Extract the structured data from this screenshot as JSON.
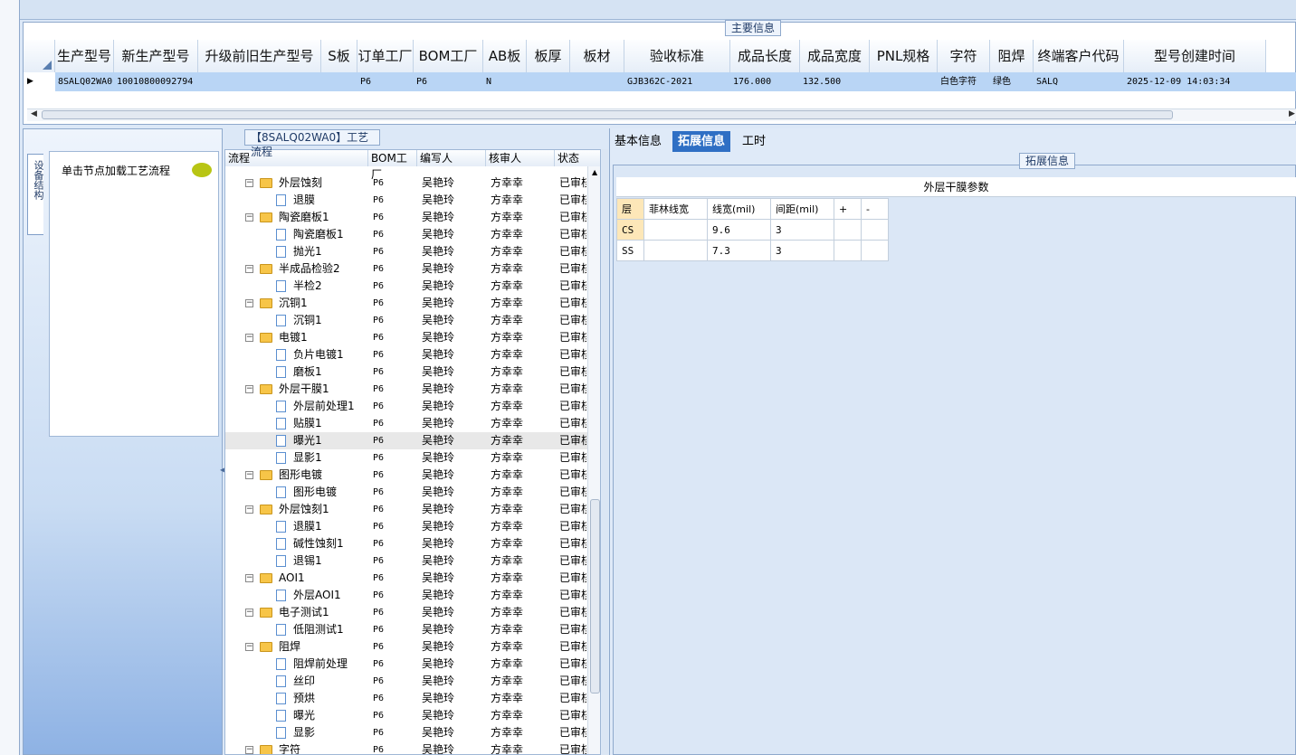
{
  "main": {
    "group_title": "主要信息",
    "columns": [
      "生产型号",
      "新生产型号",
      "升级前旧生产型号",
      "S板",
      "订单工厂",
      "BOM工厂",
      "AB板",
      "板厚",
      "板材",
      "验收标准",
      "成品长度",
      "成品宽度",
      "PNL规格",
      "字符",
      "阻焊",
      "终端客户代码",
      "型号创建时间"
    ],
    "row": [
      "8SALQ02WA0",
      "10010800092794",
      "",
      "",
      "P6",
      "P6",
      "N",
      "",
      "",
      "GJB362C-2021",
      "176.000",
      "132.500",
      "",
      "白色字符",
      "绿色",
      "SALQ",
      "2025-12-09 14:03:34"
    ]
  },
  "flow": {
    "group_title": "【8SALQ02WA0】工艺流程",
    "side_tab": "设备结构",
    "hint": "单击节点加载工艺流程",
    "headers": [
      "流程",
      "BOM工厂",
      "编写人",
      "核审人",
      "状态"
    ],
    "rows": [
      {
        "name": "外层蚀刻",
        "lvl": 0,
        "bom": "P6",
        "writer": "吴艳玲",
        "reviewer": "方幸幸",
        "status": "已审核"
      },
      {
        "name": "退膜",
        "lvl": 1,
        "bom": "P6",
        "writer": "吴艳玲",
        "reviewer": "方幸幸",
        "status": "已审核"
      },
      {
        "name": "陶瓷磨板1",
        "lvl": 0,
        "bom": "P6",
        "writer": "吴艳玲",
        "reviewer": "方幸幸",
        "status": "已审核"
      },
      {
        "name": "陶瓷磨板1",
        "lvl": 1,
        "bom": "P6",
        "writer": "吴艳玲",
        "reviewer": "方幸幸",
        "status": "已审核"
      },
      {
        "name": "抛光1",
        "lvl": 1,
        "bom": "P6",
        "writer": "吴艳玲",
        "reviewer": "方幸幸",
        "status": "已审核"
      },
      {
        "name": "半成品检验2",
        "lvl": 0,
        "bom": "P6",
        "writer": "吴艳玲",
        "reviewer": "方幸幸",
        "status": "已审核"
      },
      {
        "name": "半检2",
        "lvl": 1,
        "bom": "P6",
        "writer": "吴艳玲",
        "reviewer": "方幸幸",
        "status": "已审核"
      },
      {
        "name": "沉铜1",
        "lvl": 0,
        "bom": "P6",
        "writer": "吴艳玲",
        "reviewer": "方幸幸",
        "status": "已审核"
      },
      {
        "name": "沉铜1",
        "lvl": 1,
        "bom": "P6",
        "writer": "吴艳玲",
        "reviewer": "方幸幸",
        "status": "已审核"
      },
      {
        "name": "电镀1",
        "lvl": 0,
        "bom": "P6",
        "writer": "吴艳玲",
        "reviewer": "方幸幸",
        "status": "已审核"
      },
      {
        "name": "负片电镀1",
        "lvl": 1,
        "bom": "P6",
        "writer": "吴艳玲",
        "reviewer": "方幸幸",
        "status": "已审核"
      },
      {
        "name": "磨板1",
        "lvl": 1,
        "bom": "P6",
        "writer": "吴艳玲",
        "reviewer": "方幸幸",
        "status": "已审核"
      },
      {
        "name": "外层干膜1",
        "lvl": 0,
        "bom": "P6",
        "writer": "吴艳玲",
        "reviewer": "方幸幸",
        "status": "已审核"
      },
      {
        "name": "外层前处理1",
        "lvl": 1,
        "bom": "P6",
        "writer": "吴艳玲",
        "reviewer": "方幸幸",
        "status": "已审核"
      },
      {
        "name": "贴膜1",
        "lvl": 1,
        "bom": "P6",
        "writer": "吴艳玲",
        "reviewer": "方幸幸",
        "status": "已审核"
      },
      {
        "name": "曝光1",
        "lvl": 1,
        "bom": "P6",
        "writer": "吴艳玲",
        "reviewer": "方幸幸",
        "status": "已审核",
        "selected": true
      },
      {
        "name": "显影1",
        "lvl": 1,
        "bom": "P6",
        "writer": "吴艳玲",
        "reviewer": "方幸幸",
        "status": "已审核"
      },
      {
        "name": "图形电镀",
        "lvl": 0,
        "bom": "P6",
        "writer": "吴艳玲",
        "reviewer": "方幸幸",
        "status": "已审核"
      },
      {
        "name": "图形电镀",
        "lvl": 1,
        "bom": "P6",
        "writer": "吴艳玲",
        "reviewer": "方幸幸",
        "status": "已审核"
      },
      {
        "name": "外层蚀刻1",
        "lvl": 0,
        "bom": "P6",
        "writer": "吴艳玲",
        "reviewer": "方幸幸",
        "status": "已审核"
      },
      {
        "name": "退膜1",
        "lvl": 1,
        "bom": "P6",
        "writer": "吴艳玲",
        "reviewer": "方幸幸",
        "status": "已审核"
      },
      {
        "name": "碱性蚀刻1",
        "lvl": 1,
        "bom": "P6",
        "writer": "吴艳玲",
        "reviewer": "方幸幸",
        "status": "已审核"
      },
      {
        "name": "退锡1",
        "lvl": 1,
        "bom": "P6",
        "writer": "吴艳玲",
        "reviewer": "方幸幸",
        "status": "已审核"
      },
      {
        "name": "AOI1",
        "lvl": 0,
        "bom": "P6",
        "writer": "吴艳玲",
        "reviewer": "方幸幸",
        "status": "已审核"
      },
      {
        "name": "外层AOI1",
        "lvl": 1,
        "bom": "P6",
        "writer": "吴艳玲",
        "reviewer": "方幸幸",
        "status": "已审核"
      },
      {
        "name": "电子测试1",
        "lvl": 0,
        "bom": "P6",
        "writer": "吴艳玲",
        "reviewer": "方幸幸",
        "status": "已审核"
      },
      {
        "name": "低阻测试1",
        "lvl": 1,
        "bom": "P6",
        "writer": "吴艳玲",
        "reviewer": "方幸幸",
        "status": "已审核"
      },
      {
        "name": "阻焊",
        "lvl": 0,
        "bom": "P6",
        "writer": "吴艳玲",
        "reviewer": "方幸幸",
        "status": "已审核"
      },
      {
        "name": "阻焊前处理",
        "lvl": 1,
        "bom": "P6",
        "writer": "吴艳玲",
        "reviewer": "方幸幸",
        "status": "已审核"
      },
      {
        "name": "丝印",
        "lvl": 1,
        "bom": "P6",
        "writer": "吴艳玲",
        "reviewer": "方幸幸",
        "status": "已审核"
      },
      {
        "name": "预烘",
        "lvl": 1,
        "bom": "P6",
        "writer": "吴艳玲",
        "reviewer": "方幸幸",
        "status": "已审核"
      },
      {
        "name": "曝光",
        "lvl": 1,
        "bom": "P6",
        "writer": "吴艳玲",
        "reviewer": "方幸幸",
        "status": "已审核"
      },
      {
        "name": "显影",
        "lvl": 1,
        "bom": "P6",
        "writer": "吴艳玲",
        "reviewer": "方幸幸",
        "status": "已审核"
      },
      {
        "name": "字符",
        "lvl": 0,
        "bom": "P6",
        "writer": "吴艳玲",
        "reviewer": "方幸幸",
        "status": "已审核"
      }
    ]
  },
  "right": {
    "tabs": [
      "基本信息",
      "拓展信息",
      "工时"
    ],
    "group_title": "拓展信息",
    "table_title": "外层干膜参数",
    "headers": [
      "层",
      "菲林线宽",
      "线宽(mil)",
      "间距(mil)",
      "+",
      "-"
    ],
    "rows": [
      [
        "CS",
        "",
        "9.6",
        "3",
        "",
        ""
      ],
      [
        "SS",
        "",
        "7.3",
        "3",
        "",
        ""
      ]
    ]
  }
}
